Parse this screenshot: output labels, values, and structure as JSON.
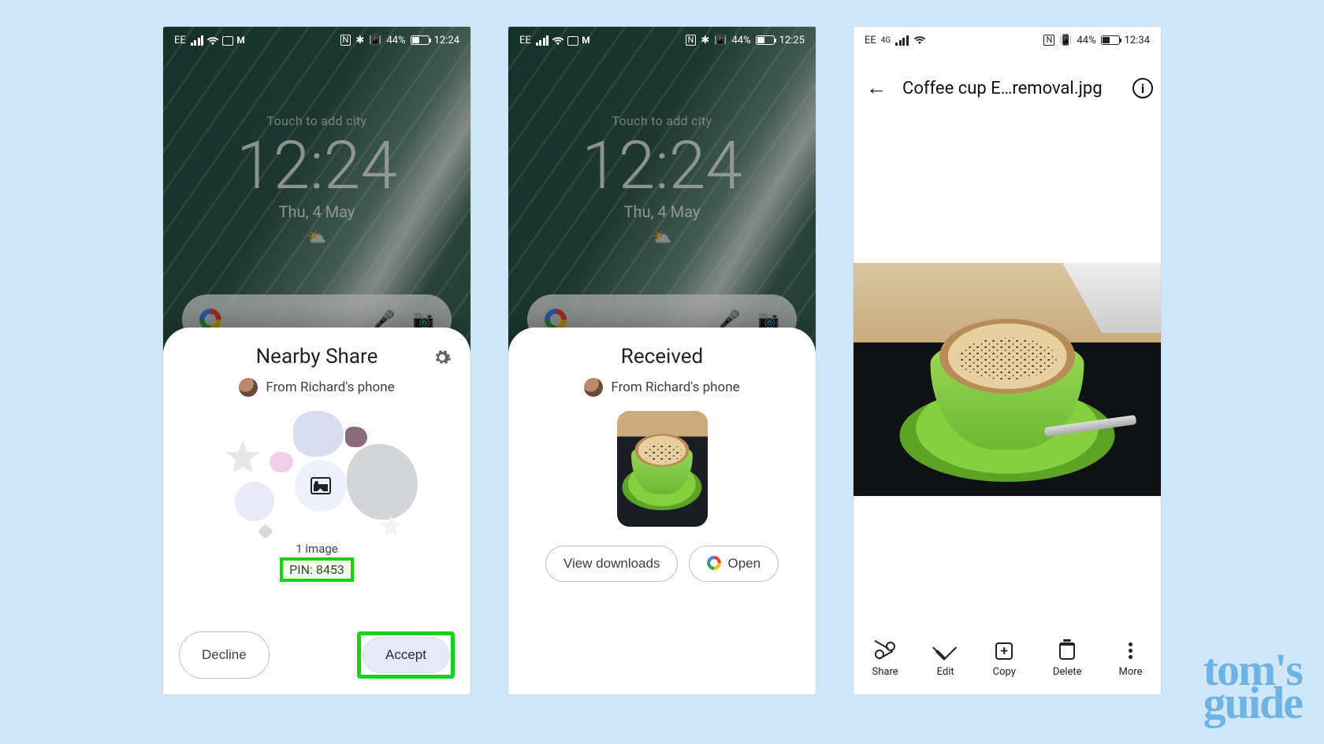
{
  "status": {
    "carrier": "EE",
    "nfc": "N",
    "bt": "✱",
    "battery_pct": "44%",
    "time12": "12:24",
    "time12b": "12:25",
    "time12c": "12:34",
    "fourg": "4G"
  },
  "homescreen": {
    "touch": "Touch to add city",
    "time": "12:24",
    "date": "Thu, 4 May",
    "weather_icon": "⛅"
  },
  "sheet1": {
    "title": "Nearby Share",
    "from": "From Richard's phone",
    "count": "1 image",
    "pin": "PIN: 8453",
    "decline": "Decline",
    "accept": "Accept"
  },
  "sheet2": {
    "title": "Received",
    "from": "From Richard's phone",
    "view_downloads": "View downloads",
    "open": "Open"
  },
  "viewer": {
    "title": "Coffee cup E…removal.jpg",
    "toolbar": {
      "share": "Share",
      "edit": "Edit",
      "copy": "Copy",
      "delete": "Delete",
      "more": "More"
    }
  },
  "watermark": {
    "l1": "tom's",
    "l2": "guide"
  }
}
